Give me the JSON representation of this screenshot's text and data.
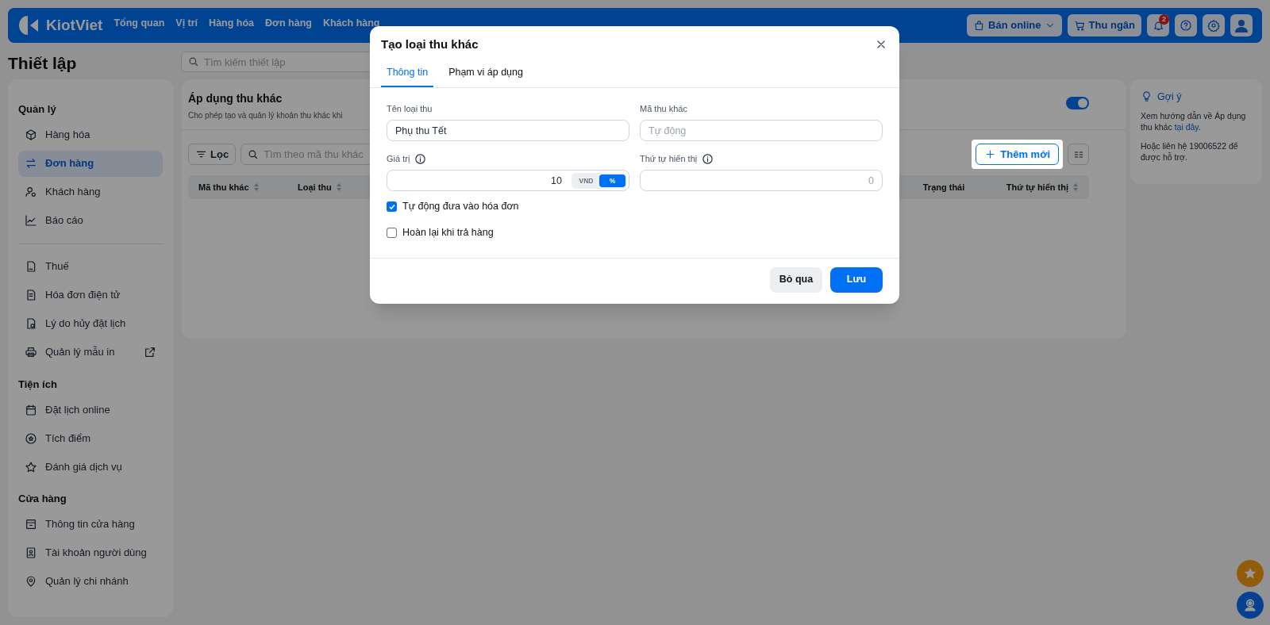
{
  "nav": {
    "logo": "KiotViet",
    "items": [
      "Tổng quan",
      "Vị trí",
      "Hàng hóa",
      "Đơn hàng",
      "Khách hàng"
    ],
    "online_button": "Bán online",
    "cashier_button": "Thu ngân",
    "notification_count": "2"
  },
  "page_title": "Thiết lập",
  "settings_search": {
    "placeholder": "Tìm kiếm thiết lập"
  },
  "sidebar": [
    {
      "title": "Quản lý",
      "items": [
        {
          "label": "Hàng hóa",
          "selected": false
        },
        {
          "label": "Đơn hàng",
          "selected": true
        },
        {
          "label": "Khách hàng",
          "selected": false
        },
        {
          "label": "Báo cáo",
          "selected": false
        }
      ]
    },
    {
      "items": [
        {
          "label": "Thuế",
          "selected": false
        },
        {
          "label": "Hóa đơn điện tử",
          "selected": false
        },
        {
          "label": "Lý do hủy đặt lịch",
          "selected": false
        },
        {
          "label": "Quản lý mẫu in",
          "selected": false,
          "external": true
        }
      ]
    },
    {
      "title": "Tiện ích",
      "items": [
        {
          "label": "Đặt lịch online",
          "selected": false
        },
        {
          "label": "Tích điểm",
          "selected": false
        },
        {
          "label": "Đánh giá dịch vụ",
          "selected": false
        }
      ]
    },
    {
      "title": "Cửa hàng",
      "items": [
        {
          "label": "Thông tin cửa hàng",
          "selected": false
        },
        {
          "label": "Tài khoản người dùng",
          "selected": false
        },
        {
          "label": "Quản lý chi nhánh",
          "selected": false
        }
      ]
    }
  ],
  "panel": {
    "title": "Áp dụng thu khác",
    "description": "Cho phép tạo và quản lý khoản thu khác khi",
    "on": true,
    "filter_button": "Lọc",
    "search": {
      "placeholder": "Tìm theo mã thu khác"
    },
    "add_button": "Thêm mới",
    "columns": [
      {
        "label": "Mã thu khác",
        "sortable": true
      },
      {
        "label": "Loại thu",
        "sortable": true
      },
      {
        "label": "Trạng thái",
        "sortable": false
      },
      {
        "label": "Thứ tự hiển thị",
        "sortable": true
      }
    ]
  },
  "hint": {
    "title": "Gợi ý",
    "text_before": "Xem hướng dẫn về Áp dụng thu khác",
    "link": "tại đây",
    "text_after": ".",
    "contact": "Hoặc liên hệ 19006522 để được hỗ trợ."
  },
  "dialog": {
    "title": "Tạo loại thu khác",
    "tabs": [
      {
        "label": "Thông tin",
        "selected": true
      },
      {
        "label": "Phạm vi áp dụng",
        "selected": false
      }
    ],
    "name_field": {
      "label": "Tên loại thu",
      "value": "Phụ thu Tết"
    },
    "code_field": {
      "label": "Mã thu khác",
      "placeholder": "Tự động"
    },
    "value_field": {
      "label": "Giá trị",
      "value": "10",
      "units": [
        {
          "label": "VND",
          "selected": false
        },
        {
          "label": "%",
          "selected": true
        }
      ]
    },
    "order_field": {
      "label": "Thứ tự hiển thị",
      "placeholder": "0"
    },
    "checkboxes": [
      {
        "label": "Tự động đưa vào hóa đơn",
        "checked": true
      },
      {
        "label": "Hoàn lại khi trả hàng",
        "checked": false
      }
    ],
    "cancel_button": "Bỏ qua",
    "save_button": "Lưu"
  }
}
